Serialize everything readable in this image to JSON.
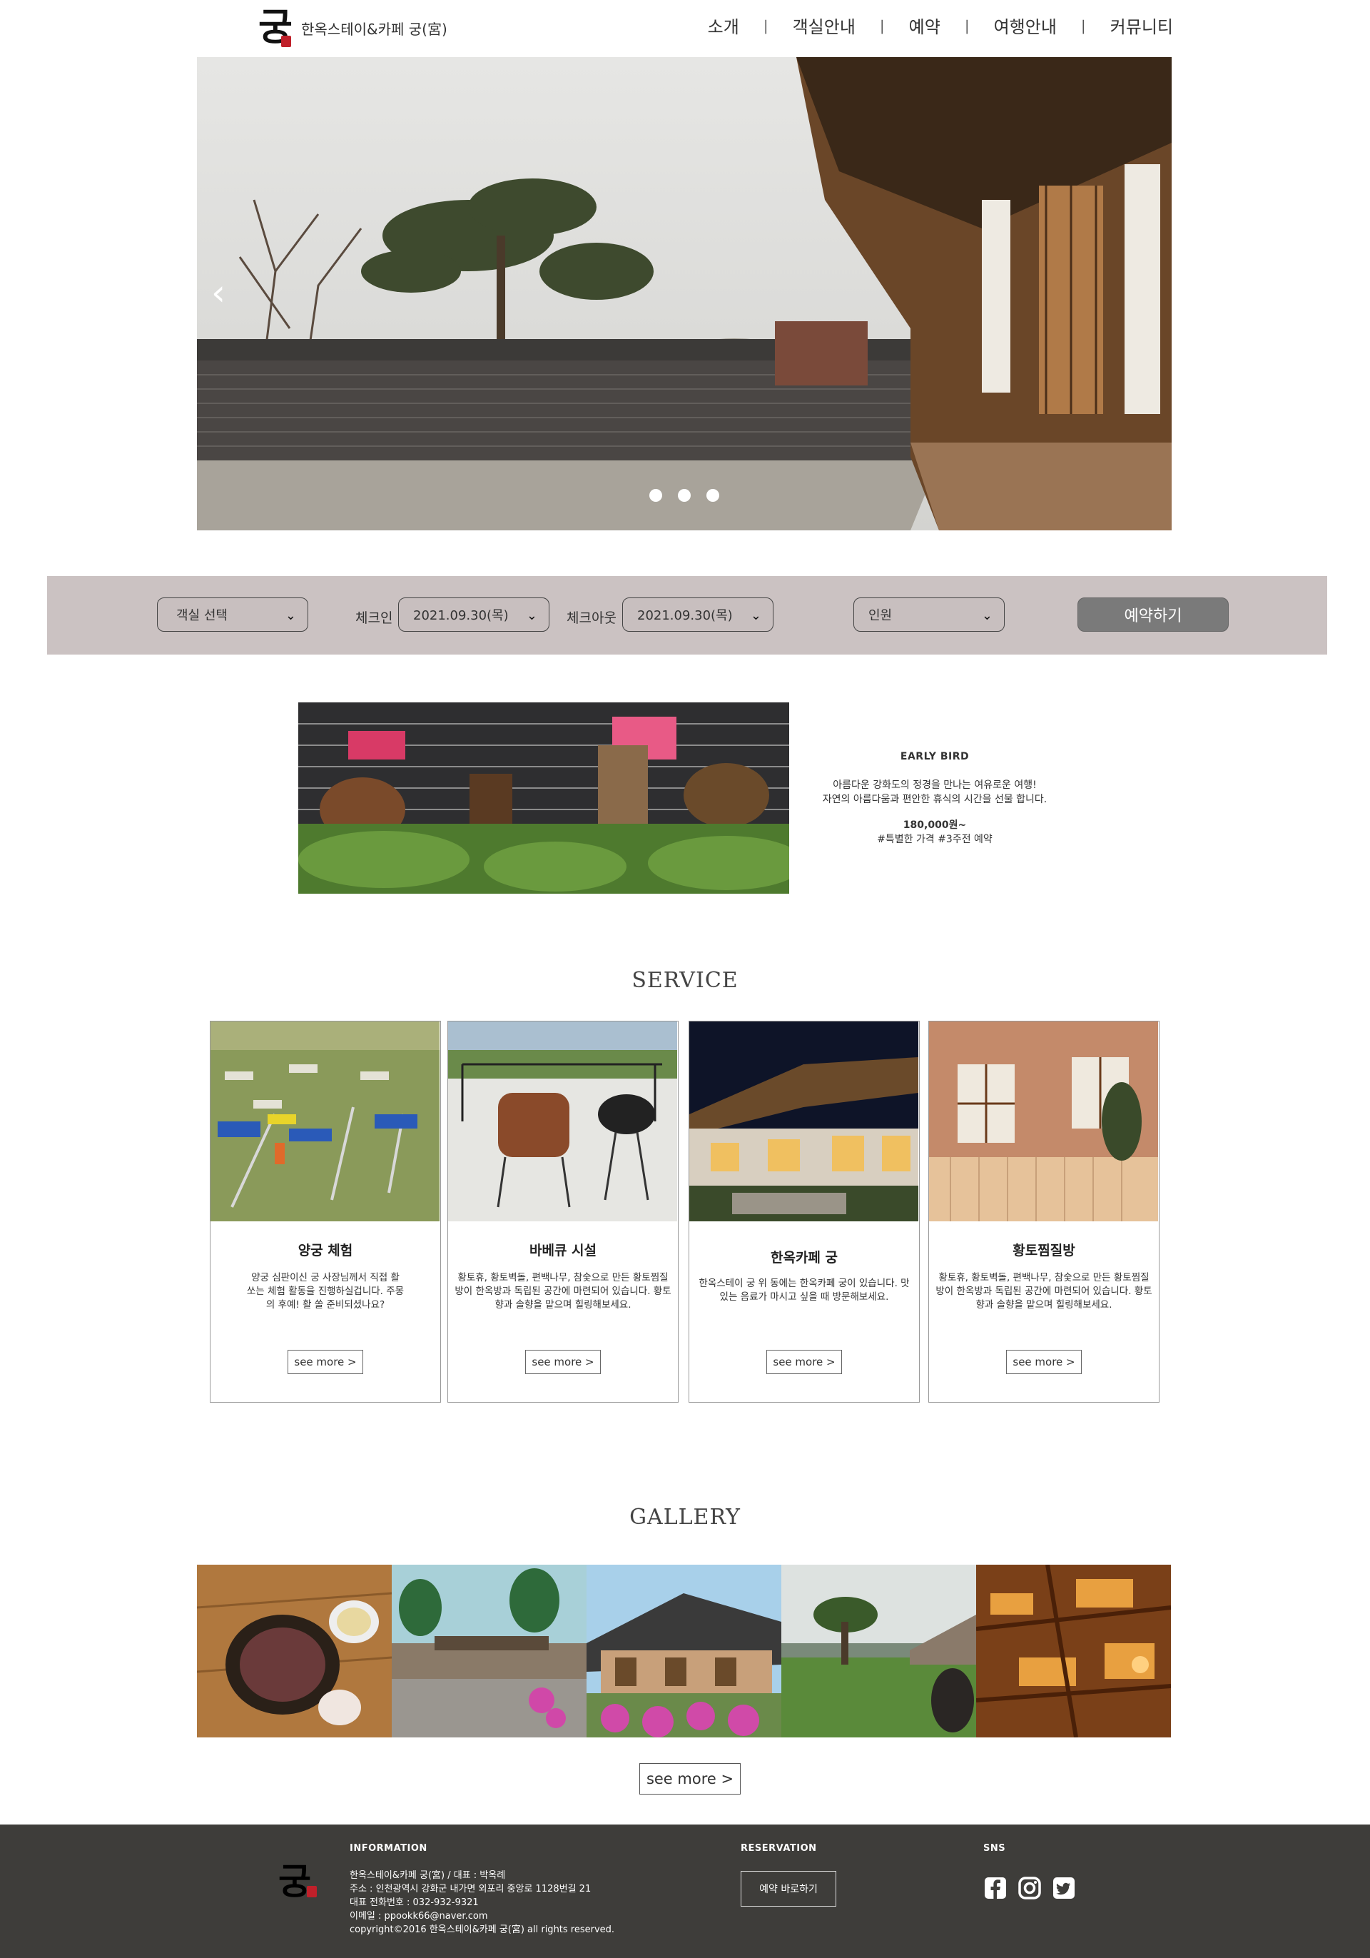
{
  "header": {
    "logo_glyph": "궁",
    "logo_text": "한옥스테이&카페 궁(宮)",
    "nav": [
      "소개",
      "객실안내",
      "예약",
      "여행안내",
      "커뮤니티"
    ],
    "separator": "|"
  },
  "hero": {
    "prev_icon": "chevron-left-icon",
    "prev_glyph": "‹",
    "slide_count": 3
  },
  "booking": {
    "room_select": "객실 선택",
    "checkin_label": "체크인",
    "checkin_value": "2021.09.30(목)",
    "checkout_label": "체크아웃",
    "checkout_value": "2021.09.30(목)",
    "guests_select": "인원",
    "submit_label": "예약하기",
    "chevron": "⌄"
  },
  "early_bird": {
    "title": "EARLY BIRD",
    "line1": "아름다운 강화도의 정경을 만나는 여유로운 여행!",
    "line2": "자연의 아름다움과 편안한 휴식의 시간을 선물 합니다.",
    "price": "180,000원~",
    "tags": "#특별한 가격 #3주전 예약"
  },
  "service": {
    "title": "SERVICE",
    "cards": [
      {
        "title": "양궁 체험",
        "desc": "양궁 심판이신 궁 사장님께서 직접 활 쏘는 체험 활동을 진행하실겁니다. 주몽의 후예! 활 쏠 준비되셨나요?",
        "more": "see more >"
      },
      {
        "title": "바베큐 시설",
        "desc": "황토휴, 황토벽돌, 편백나무, 참숯으로 만든 황토찜질방이 한옥방과 독립된 공간에 마련되어 있습니다. 황토향과 솔향을 맡으며 힐링해보세요.",
        "more": "see more >"
      },
      {
        "title": "한옥카페 궁",
        "desc": "한옥스테이 궁 위 동에는 한옥카페 궁이 있습니다. 맛있는 음료가 마시고 싶을 때 방문해보세요.",
        "more": "see more >"
      },
      {
        "title": "황토찜질방",
        "desc": "황토휴, 황토벽돌, 편백나무, 참숯으로 만든 황토찜질방이 한옥방과 독립된 공간에 마련되어 있습니다. 황토향과 솔향을 맡으며 힐링해보세요.",
        "more": "see more >"
      }
    ]
  },
  "gallery": {
    "title": "GALLERY",
    "more": "see more >"
  },
  "footer": {
    "logo_glyph": "궁",
    "info_heading": "INFORMATION",
    "info_lines": [
      "한옥스테이&카페 궁(宮) / 대표 : 박옥례",
      "주소 : 인천광역시 강화군 내가면 외포리 중앙로 1128번길 21",
      "대표 전화번호 : 032-932-9321",
      "이메일 : ppookk66@naver.com",
      "copyright©2016 한옥스테이&카페 궁(宮) all rights reserved."
    ],
    "reservation_heading": "RESERVATION",
    "reservation_button": "예약 바로하기",
    "sns_heading": "SNS",
    "sns_icons": [
      "facebook-icon",
      "instagram-icon",
      "twitter-icon"
    ]
  },
  "colors": {
    "booking_bg": "#cbc2c2",
    "book_button": "#7a7a7a",
    "footer_bg": "#3e3d3a",
    "seal_red": "#c0202a"
  }
}
